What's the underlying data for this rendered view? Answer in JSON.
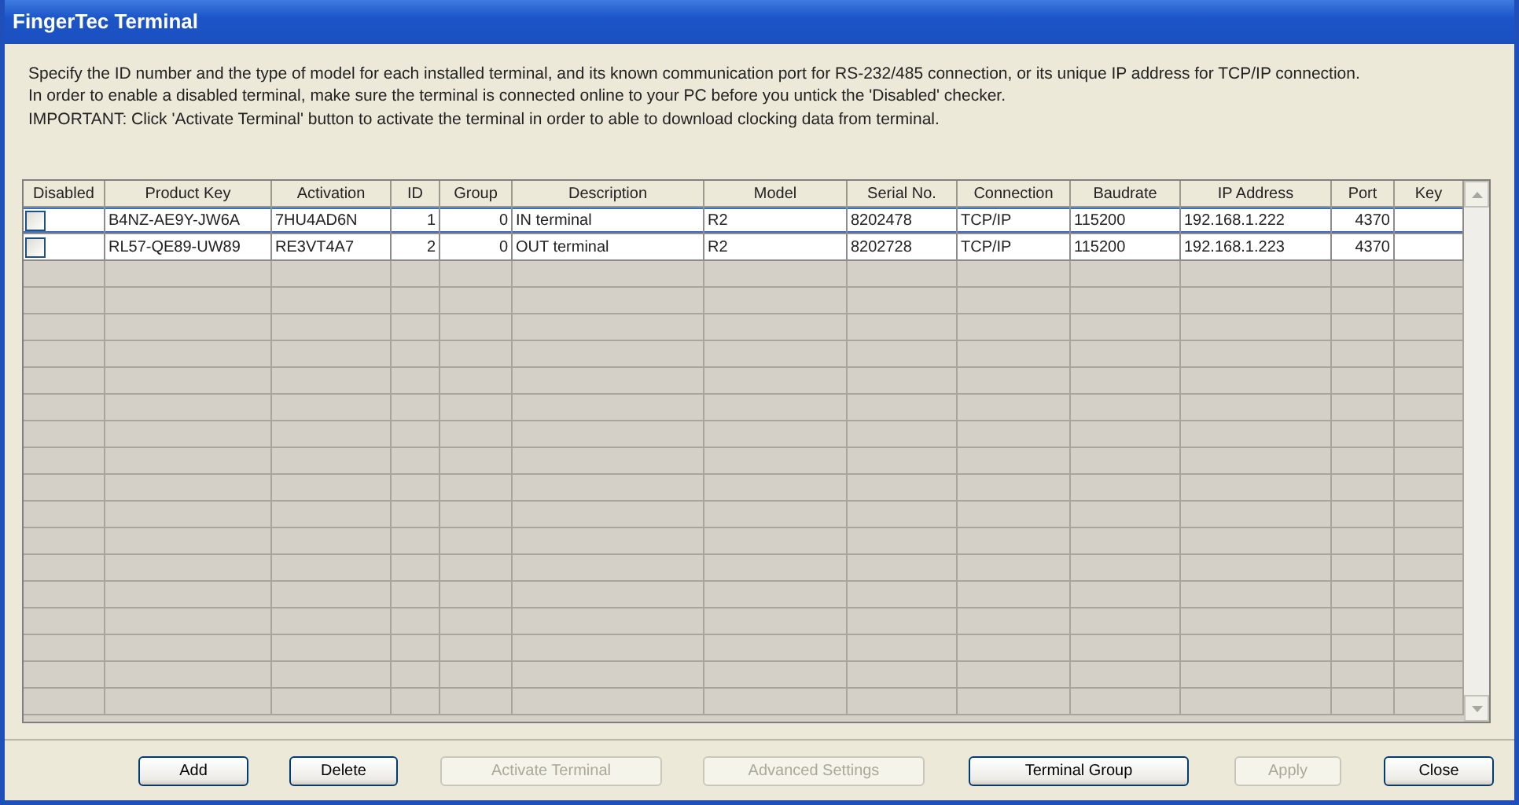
{
  "window": {
    "title": "FingerTec Terminal"
  },
  "instructions": [
    "Specify the ID number and the type of model for each installed terminal, and its known communication port for RS-232/485 connection, or its unique IP address for TCP/IP connection.",
    "In order to enable a disabled terminal, make sure the terminal is connected online to your PC before you untick the 'Disabled' checker.",
    "IMPORTANT: Click 'Activate Terminal' button to activate the terminal in order to able to download clocking data from terminal."
  ],
  "table": {
    "columns": [
      "Disabled",
      "Product Key",
      "Activation",
      "ID",
      "Group",
      "Description",
      "Model",
      "Serial No.",
      "Connection",
      "Baudrate",
      "IP Address",
      "Port",
      "Key"
    ],
    "rows": [
      {
        "selected": true,
        "disabled": false,
        "product_key": "B4NZ-AE9Y-JW6A",
        "activation": "7HU4AD6N",
        "id": "1",
        "group": "0",
        "description": "IN terminal",
        "model": "R2",
        "serial_no": "8202478",
        "connection": "TCP/IP",
        "baudrate": "115200",
        "ip_address": "192.168.1.222",
        "port": "4370"
      },
      {
        "selected": false,
        "disabled": false,
        "product_key": "RL57-QE89-UW89",
        "activation": "RE3VT4A7",
        "id": "2",
        "group": "0",
        "description": "OUT terminal",
        "model": "R2",
        "serial_no": "8202728",
        "connection": "TCP/IP",
        "baudrate": "115200",
        "ip_address": "192.168.1.223",
        "port": "4370"
      }
    ]
  },
  "buttons": [
    {
      "label": "Add",
      "disabled": false
    },
    {
      "label": "Delete",
      "disabled": false
    },
    {
      "label": "Activate Terminal",
      "disabled": true
    },
    {
      "label": "Advanced Settings",
      "disabled": true
    },
    {
      "label": "Terminal Group",
      "disabled": false
    },
    {
      "label": "Apply",
      "disabled": true
    },
    {
      "label": "Close",
      "disabled": false
    }
  ]
}
